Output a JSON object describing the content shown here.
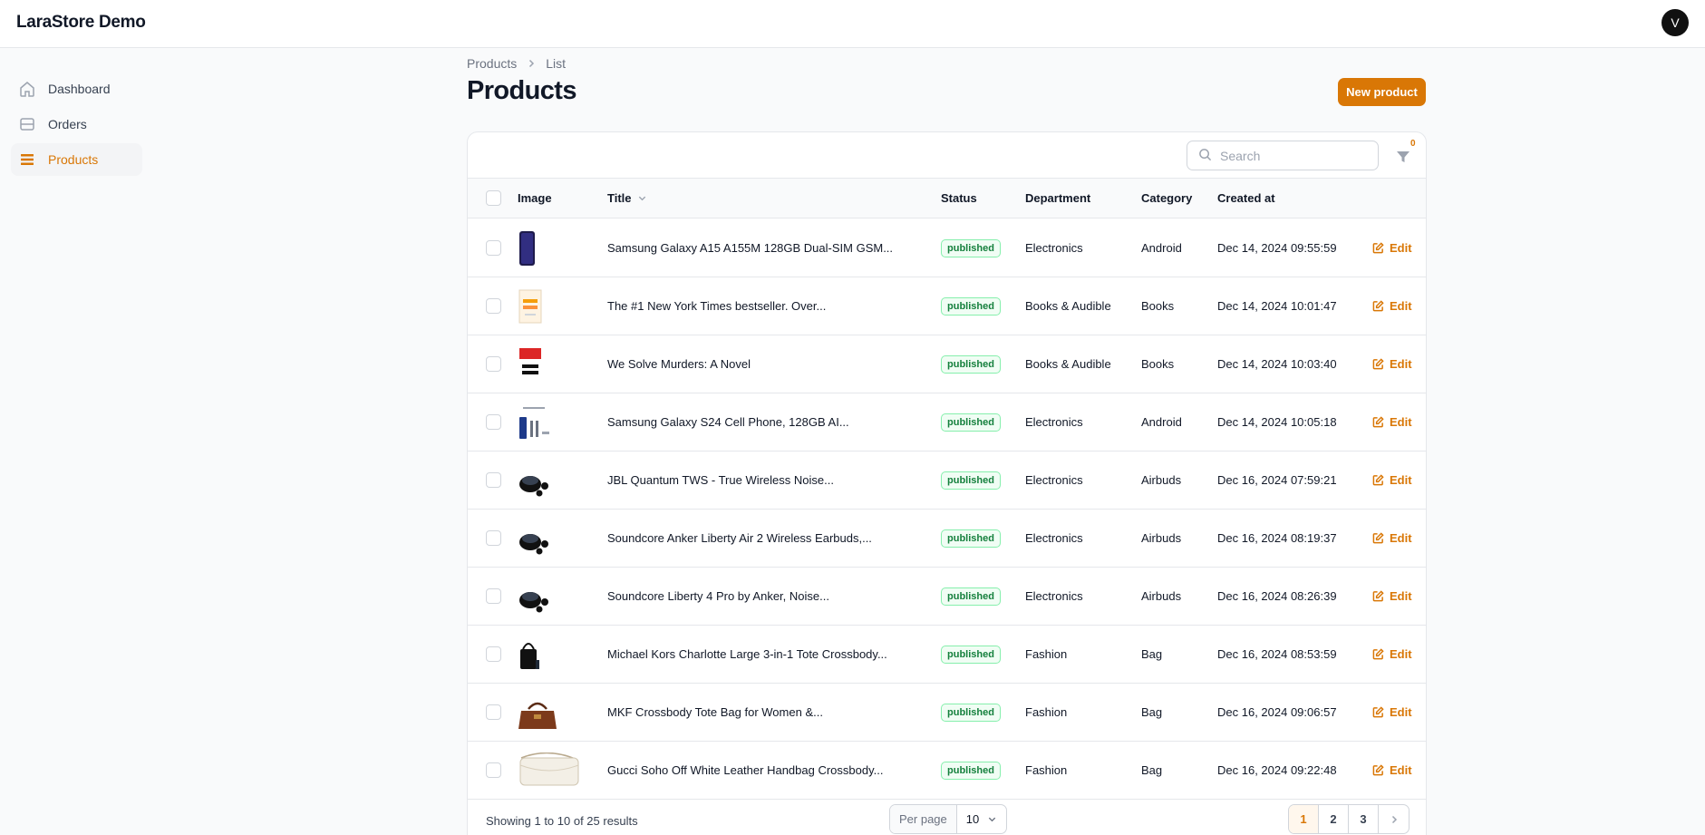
{
  "app": {
    "brand": "LaraStore Demo",
    "avatar_initial": "V"
  },
  "sidebar": {
    "items": [
      {
        "label": "Dashboard",
        "icon": "home-icon",
        "active": false
      },
      {
        "label": "Orders",
        "icon": "inbox-icon",
        "active": false
      },
      {
        "label": "Products",
        "icon": "list-icon",
        "active": true
      }
    ]
  },
  "breadcrumb": {
    "items": [
      "Products",
      "List"
    ]
  },
  "page": {
    "title": "Products",
    "new_button_label": "New product"
  },
  "table": {
    "search_placeholder": "Search",
    "filter_count": "0",
    "columns": [
      "Image",
      "Title",
      "Status",
      "Department",
      "Category",
      "Created at"
    ],
    "edit_label": "Edit",
    "rows": [
      {
        "title": "Samsung Galaxy A15 A155M 128GB Dual-SIM GSM...",
        "status": "published",
        "department": "Electronics",
        "category": "Android",
        "created_at": "Dec 14, 2024 09:55:59",
        "thumb": "phone"
      },
      {
        "title": "The #1 New York Times bestseller. Over...",
        "status": "published",
        "department": "Books & Audible",
        "category": "Books",
        "created_at": "Dec 14, 2024 10:01:47",
        "thumb": "book-light"
      },
      {
        "title": "We Solve Murders: A Novel",
        "status": "published",
        "department": "Books & Audible",
        "category": "Books",
        "created_at": "Dec 14, 2024 10:03:40",
        "thumb": "book-red"
      },
      {
        "title": "Samsung Galaxy S24 Cell Phone, 128GB AI...",
        "status": "published",
        "department": "Electronics",
        "category": "Android",
        "created_at": "Dec 14, 2024 10:05:18",
        "thumb": "phone-kit"
      },
      {
        "title": "JBL Quantum TWS - True Wireless Noise...",
        "status": "published",
        "department": "Electronics",
        "category": "Airbuds",
        "created_at": "Dec 16, 2024 07:59:21",
        "thumb": "earbuds"
      },
      {
        "title": "Soundcore Anker Liberty Air 2 Wireless Earbuds,...",
        "status": "published",
        "department": "Electronics",
        "category": "Airbuds",
        "created_at": "Dec 16, 2024 08:19:37",
        "thumb": "earbuds"
      },
      {
        "title": "Soundcore Liberty 4 Pro by Anker, Noise...",
        "status": "published",
        "department": "Electronics",
        "category": "Airbuds",
        "created_at": "Dec 16, 2024 08:26:39",
        "thumb": "earbuds"
      },
      {
        "title": "Michael Kors Charlotte Large 3-in-1 Tote Crossbody...",
        "status": "published",
        "department": "Fashion",
        "category": "Bag",
        "created_at": "Dec 16, 2024 08:53:59",
        "thumb": "bag-black"
      },
      {
        "title": "MKF Crossbody Tote Bag for Women &...",
        "status": "published",
        "department": "Fashion",
        "category": "Bag",
        "created_at": "Dec 16, 2024 09:06:57",
        "thumb": "bag-brown"
      },
      {
        "title": "Gucci Soho Off White Leather Handbag Crossbody...",
        "status": "published",
        "department": "Fashion",
        "category": "Bag",
        "created_at": "Dec 16, 2024 09:22:48",
        "thumb": "bag-white"
      }
    ]
  },
  "footer": {
    "showing": "Showing 1 to 10 of 25 results",
    "per_page_label": "Per page",
    "per_page_value": "10",
    "pages": [
      "1",
      "2",
      "3"
    ],
    "current_page": "1"
  },
  "colors": {
    "accent": "#d97706",
    "success": "#15803d",
    "border": "#e5e7eb"
  }
}
